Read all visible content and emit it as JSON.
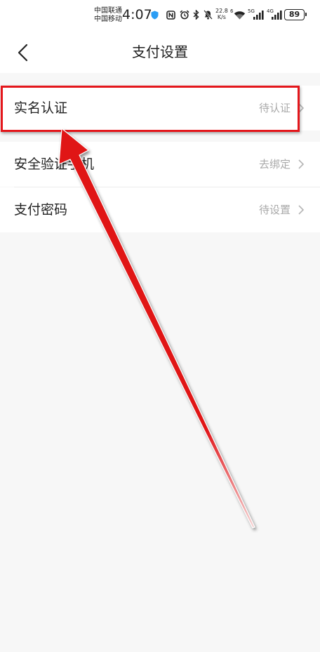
{
  "status_bar": {
    "carrier_1": "中国联通",
    "carrier_2": "中国移动",
    "time": "4:07",
    "net_speed_value": "22.8",
    "net_speed_unit": "K/s",
    "wifi_label": "6",
    "signal_1_label": "5G",
    "signal_2_label": "4G",
    "battery": "89",
    "icons": [
      "shield-icon",
      "nfc-icon",
      "alarm-icon",
      "bluetooth-icon",
      "mute-icon",
      "wifi-icon",
      "signal-5g-icon",
      "signal-4g-icon",
      "battery-icon"
    ]
  },
  "header": {
    "back_icon": "chevron-left-icon",
    "title": "支付设置"
  },
  "settings": {
    "items": [
      {
        "label": "实名认证",
        "value": "待认证"
      },
      {
        "label": "安全验证手机",
        "value": "去绑定"
      },
      {
        "label": "支付密码",
        "value": "待设置"
      }
    ]
  },
  "annotation": {
    "color": "#e4161b",
    "target": "实名认证"
  },
  "colors": {
    "background": "#f7f7f7",
    "surface": "#ffffff",
    "secondary_text": "#a9a9a9"
  }
}
